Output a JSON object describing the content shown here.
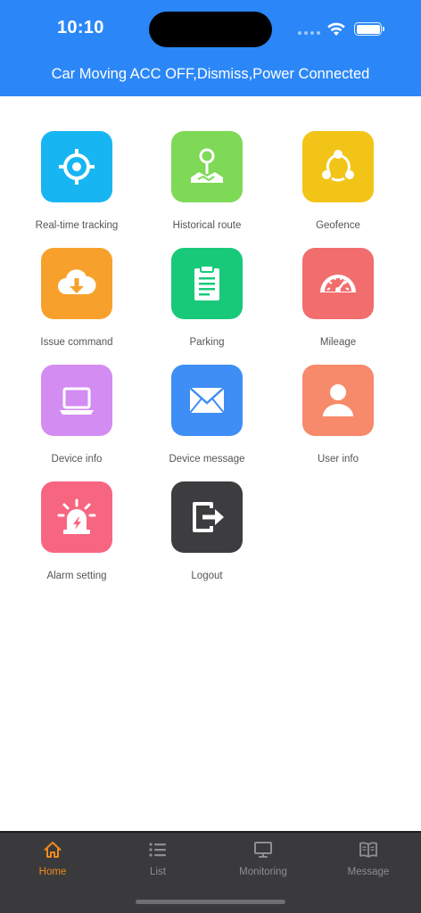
{
  "status_bar": {
    "time": "10:10"
  },
  "header": {
    "title": "Car Moving ACC OFF,Dismiss,Power Connected"
  },
  "menu": [
    {
      "label": "Real-time tracking",
      "icon": "crosshair-icon",
      "color": "#17b6f2"
    },
    {
      "label": "Historical route",
      "icon": "map-pin-icon",
      "color": "#7ed957"
    },
    {
      "label": "Geofence",
      "icon": "share-nodes-icon",
      "color": "#f2c417"
    },
    {
      "label": "Issue command",
      "icon": "cloud-download-icon",
      "color": "#f7a12c"
    },
    {
      "label": "Parking",
      "icon": "clipboard-icon",
      "color": "#18c97a"
    },
    {
      "label": "Mileage",
      "icon": "speedometer-icon",
      "color": "#f26d6d"
    },
    {
      "label": "Device info",
      "icon": "laptop-icon",
      "color": "#d38cf2"
    },
    {
      "label": "Device message",
      "icon": "envelope-icon",
      "color": "#3f8ef5"
    },
    {
      "label": "User info",
      "icon": "user-icon",
      "color": "#f78a6a"
    },
    {
      "label": "Alarm setting",
      "icon": "alarm-light-icon",
      "color": "#f76681"
    },
    {
      "label": "Logout",
      "icon": "logout-icon",
      "color": "#3d3d3f"
    }
  ],
  "tabbar": {
    "active_color": "#f08a1c",
    "inactive_color": "#8e8e93",
    "tabs": [
      {
        "label": "Home",
        "icon": "home-icon",
        "active": true
      },
      {
        "label": "List",
        "icon": "list-icon",
        "active": false
      },
      {
        "label": "Monitoring",
        "icon": "monitor-icon",
        "active": false
      },
      {
        "label": "Message",
        "icon": "book-icon",
        "active": false
      }
    ]
  }
}
